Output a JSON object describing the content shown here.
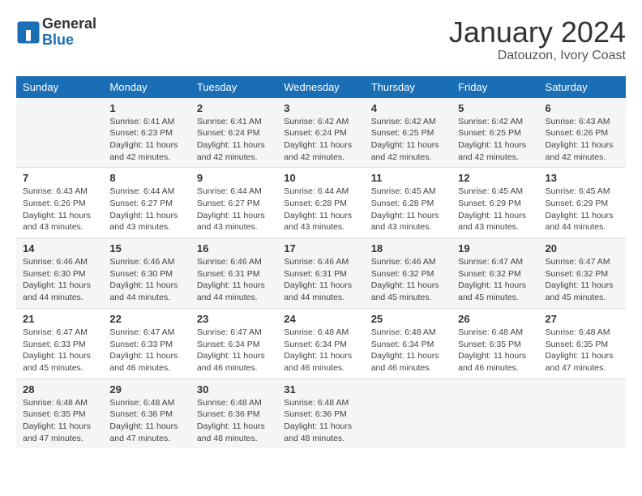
{
  "logo": {
    "general": "General",
    "blue": "Blue"
  },
  "title": "January 2024",
  "location": "Datouzon, Ivory Coast",
  "weekdays": [
    "Sunday",
    "Monday",
    "Tuesday",
    "Wednesday",
    "Thursday",
    "Friday",
    "Saturday"
  ],
  "weeks": [
    [
      {
        "day": "",
        "info": ""
      },
      {
        "day": "1",
        "info": "Sunrise: 6:41 AM\nSunset: 6:23 PM\nDaylight: 11 hours\nand 42 minutes."
      },
      {
        "day": "2",
        "info": "Sunrise: 6:41 AM\nSunset: 6:24 PM\nDaylight: 11 hours\nand 42 minutes."
      },
      {
        "day": "3",
        "info": "Sunrise: 6:42 AM\nSunset: 6:24 PM\nDaylight: 11 hours\nand 42 minutes."
      },
      {
        "day": "4",
        "info": "Sunrise: 6:42 AM\nSunset: 6:25 PM\nDaylight: 11 hours\nand 42 minutes."
      },
      {
        "day": "5",
        "info": "Sunrise: 6:42 AM\nSunset: 6:25 PM\nDaylight: 11 hours\nand 42 minutes."
      },
      {
        "day": "6",
        "info": "Sunrise: 6:43 AM\nSunset: 6:26 PM\nDaylight: 11 hours\nand 42 minutes."
      }
    ],
    [
      {
        "day": "7",
        "info": "Sunrise: 6:43 AM\nSunset: 6:26 PM\nDaylight: 11 hours\nand 43 minutes."
      },
      {
        "day": "8",
        "info": "Sunrise: 6:44 AM\nSunset: 6:27 PM\nDaylight: 11 hours\nand 43 minutes."
      },
      {
        "day": "9",
        "info": "Sunrise: 6:44 AM\nSunset: 6:27 PM\nDaylight: 11 hours\nand 43 minutes."
      },
      {
        "day": "10",
        "info": "Sunrise: 6:44 AM\nSunset: 6:28 PM\nDaylight: 11 hours\nand 43 minutes."
      },
      {
        "day": "11",
        "info": "Sunrise: 6:45 AM\nSunset: 6:28 PM\nDaylight: 11 hours\nand 43 minutes."
      },
      {
        "day": "12",
        "info": "Sunrise: 6:45 AM\nSunset: 6:29 PM\nDaylight: 11 hours\nand 43 minutes."
      },
      {
        "day": "13",
        "info": "Sunrise: 6:45 AM\nSunset: 6:29 PM\nDaylight: 11 hours\nand 44 minutes."
      }
    ],
    [
      {
        "day": "14",
        "info": "Sunrise: 6:46 AM\nSunset: 6:30 PM\nDaylight: 11 hours\nand 44 minutes."
      },
      {
        "day": "15",
        "info": "Sunrise: 6:46 AM\nSunset: 6:30 PM\nDaylight: 11 hours\nand 44 minutes."
      },
      {
        "day": "16",
        "info": "Sunrise: 6:46 AM\nSunset: 6:31 PM\nDaylight: 11 hours\nand 44 minutes."
      },
      {
        "day": "17",
        "info": "Sunrise: 6:46 AM\nSunset: 6:31 PM\nDaylight: 11 hours\nand 44 minutes."
      },
      {
        "day": "18",
        "info": "Sunrise: 6:46 AM\nSunset: 6:32 PM\nDaylight: 11 hours\nand 45 minutes."
      },
      {
        "day": "19",
        "info": "Sunrise: 6:47 AM\nSunset: 6:32 PM\nDaylight: 11 hours\nand 45 minutes."
      },
      {
        "day": "20",
        "info": "Sunrise: 6:47 AM\nSunset: 6:32 PM\nDaylight: 11 hours\nand 45 minutes."
      }
    ],
    [
      {
        "day": "21",
        "info": "Sunrise: 6:47 AM\nSunset: 6:33 PM\nDaylight: 11 hours\nand 45 minutes."
      },
      {
        "day": "22",
        "info": "Sunrise: 6:47 AM\nSunset: 6:33 PM\nDaylight: 11 hours\nand 46 minutes."
      },
      {
        "day": "23",
        "info": "Sunrise: 6:47 AM\nSunset: 6:34 PM\nDaylight: 11 hours\nand 46 minutes."
      },
      {
        "day": "24",
        "info": "Sunrise: 6:48 AM\nSunset: 6:34 PM\nDaylight: 11 hours\nand 46 minutes."
      },
      {
        "day": "25",
        "info": "Sunrise: 6:48 AM\nSunset: 6:34 PM\nDaylight: 11 hours\nand 46 minutes."
      },
      {
        "day": "26",
        "info": "Sunrise: 6:48 AM\nSunset: 6:35 PM\nDaylight: 11 hours\nand 46 minutes."
      },
      {
        "day": "27",
        "info": "Sunrise: 6:48 AM\nSunset: 6:35 PM\nDaylight: 11 hours\nand 47 minutes."
      }
    ],
    [
      {
        "day": "28",
        "info": "Sunrise: 6:48 AM\nSunset: 6:35 PM\nDaylight: 11 hours\nand 47 minutes."
      },
      {
        "day": "29",
        "info": "Sunrise: 6:48 AM\nSunset: 6:36 PM\nDaylight: 11 hours\nand 47 minutes."
      },
      {
        "day": "30",
        "info": "Sunrise: 6:48 AM\nSunset: 6:36 PM\nDaylight: 11 hours\nand 48 minutes."
      },
      {
        "day": "31",
        "info": "Sunrise: 6:48 AM\nSunset: 6:36 PM\nDaylight: 11 hours\nand 48 minutes."
      },
      {
        "day": "",
        "info": ""
      },
      {
        "day": "",
        "info": ""
      },
      {
        "day": "",
        "info": ""
      }
    ]
  ]
}
